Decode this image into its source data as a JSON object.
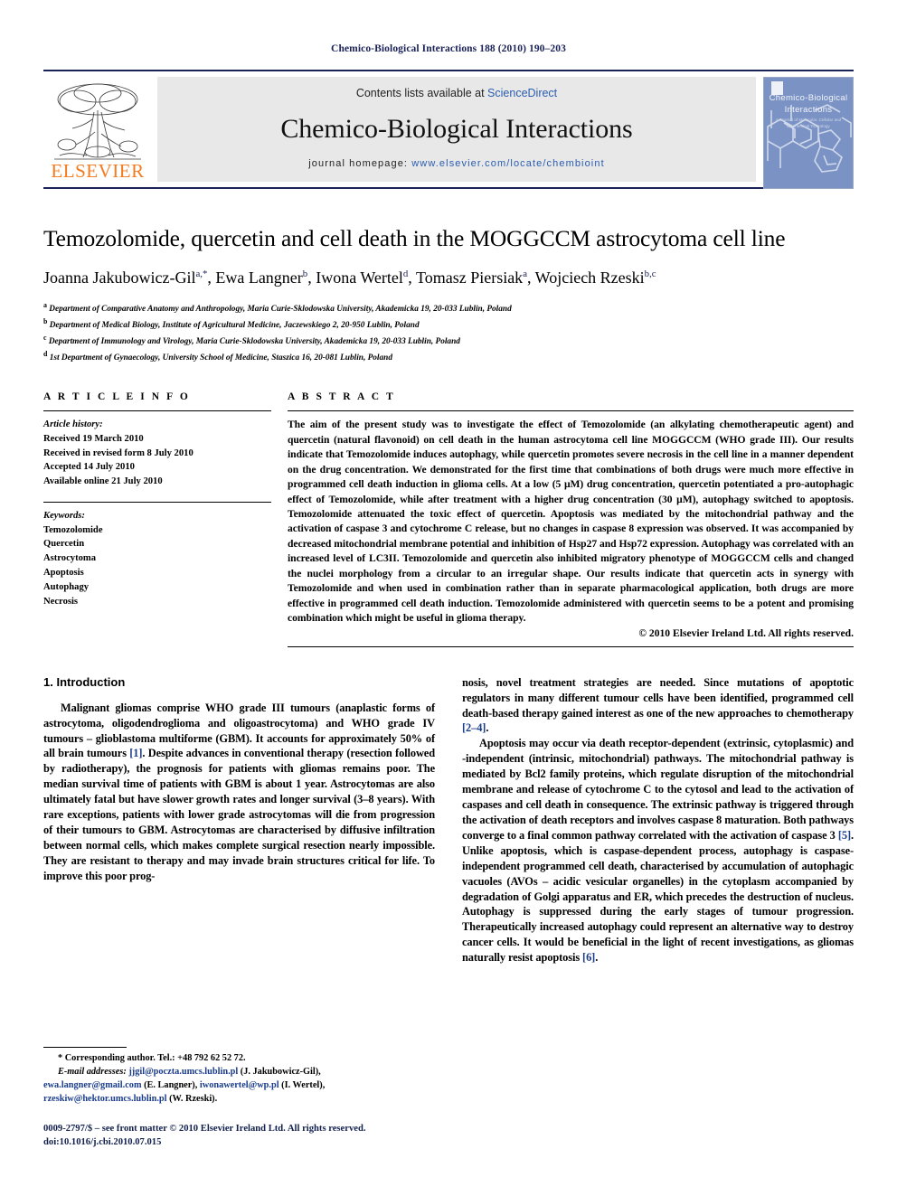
{
  "running_head": "Chemico-Biological Interactions 188 (2010) 190–203",
  "masthead": {
    "contents_prefix": "Contents lists available at ",
    "sciencedirect": "ScienceDirect",
    "journal_title": "Chemico-Biological Interactions",
    "homepage_prefix": "journal homepage: ",
    "homepage_url": "www.elsevier.com/locate/chembioint",
    "publisher": "ELSEVIER",
    "cover": {
      "line1": "Chemico-Biological",
      "line2": "Interactions",
      "line3": "A Journal of Molecular, Cellular and Biochemical Toxicology"
    },
    "accent_blue": "#1a2258",
    "link_blue": "#2a5db0",
    "elsevier_orange": "#f47b20",
    "cover_bg": "#7b93c4"
  },
  "article": {
    "title": "Temozolomide, quercetin and cell death in the MOGGCCM astrocytoma cell line",
    "authors_html": "Joanna Jakubowicz-Gil<sup>a,*</sup>, Ewa Langner<sup>b</sup>, Iwona Wertel<sup>d</sup>, Tomasz Piersiak<sup>a</sup>, Wojciech Rzeski<sup>b,c</sup>",
    "affiliations": [
      {
        "marker": "a",
        "text": "Department of Comparative Anatomy and Anthropology, Maria Curie-Sklodowska University, Akademicka 19, 20-033 Lublin, Poland"
      },
      {
        "marker": "b",
        "text": "Department of Medical Biology, Institute of Agricultural Medicine, Jaczewskiego 2, 20-950 Lublin, Poland"
      },
      {
        "marker": "c",
        "text": "Department of Immunology and Virology, Maria Curie-Sklodowska University, Akademicka 19, 20-033 Lublin, Poland"
      },
      {
        "marker": "d",
        "text": "1st Department of Gynaecology, University School of Medicine, Staszica 16, 20-081 Lublin, Poland"
      }
    ]
  },
  "info": {
    "label": "A R T I C L E   I N F O",
    "history_label": "Article history:",
    "history": [
      "Received 19 March 2010",
      "Received in revised form 8 July 2010",
      "Accepted 14 July 2010",
      "Available online 21 July 2010"
    ],
    "keywords_label": "Keywords:",
    "keywords": [
      "Temozolomide",
      "Quercetin",
      "Astrocytoma",
      "Apoptosis",
      "Autophagy",
      "Necrosis"
    ]
  },
  "abstract": {
    "label": "A B S T R A C T",
    "text": "The aim of the present study was to investigate the effect of Temozolomide (an alkylating chemotherapeutic agent) and quercetin (natural flavonoid) on cell death in the human astrocytoma cell line MOGGCCM (WHO grade III). Our results indicate that Temozolomide induces autophagy, while quercetin promotes severe necrosis in the cell line in a manner dependent on the drug concentration. We demonstrated for the first time that combinations of both drugs were much more effective in programmed cell death induction in glioma cells. At a low (5 μM) drug concentration, quercetin potentiated a pro-autophagic effect of Temozolomide, while after treatment with a higher drug concentration (30 μM), autophagy switched to apoptosis. Temozolomide attenuated the toxic effect of quercetin. Apoptosis was mediated by the mitochondrial pathway and the activation of caspase 3 and cytochrome C release, but no changes in caspase 8 expression was observed. It was accompanied by decreased mitochondrial membrane potential and inhibition of Hsp27 and Hsp72 expression. Autophagy was correlated with an increased level of LC3II. Temozolomide and quercetin also inhibited migratory phenotype of MOGGCCM cells and changed the nuclei morphology from a circular to an irregular shape. Our results indicate that quercetin acts in synergy with Temozolomide and when used in combination rather than in separate pharmacological application, both drugs are more effective in programmed cell death induction. Temozolomide administered with quercetin seems to be a potent and promising combination which might be useful in glioma therapy.",
    "copyright": "© 2010 Elsevier Ireland Ltd. All rights reserved."
  },
  "introduction": {
    "heading": "1. Introduction",
    "left_paragraph_1_pre": "Malignant gliomas comprise WHO grade III tumours (anaplastic forms of astrocytoma, oligodendroglioma and oligoastrocytoma) and WHO grade IV tumours – glioblastoma multiforme (GBM). It accounts for approximately 50% of all brain tumours ",
    "ref_1": "[1]",
    "left_paragraph_1_post": ". Despite advances in conventional therapy (resection followed by radiotherapy), the prognosis for patients with gliomas remains poor. The median survival time of patients with GBM is about 1 year. Astrocytomas are also ultimately fatal but have slower growth rates and longer survival (3–8 years). With rare exceptions, patients with lower grade astrocytomas will die from progression of their tumours to GBM. Astrocytomas are characterised by diffusive infiltration between normal cells, which makes complete surgical resection nearly impossible. They are resistant to therapy and may invade brain structures critical for life. To improve this poor prog-",
    "right_paragraph_1_pre": "nosis, novel treatment strategies are needed. Since mutations of apoptotic regulators in many different tumour cells have been identified, programmed cell death-based therapy gained interest as one of the new approaches to chemotherapy ",
    "ref_2_4": "[2–4]",
    "right_paragraph_1_post": ".",
    "right_paragraph_2_pre": "Apoptosis may occur via death receptor-dependent (extrinsic, cytoplasmic) and -independent (intrinsic, mitochondrial) pathways. The mitochondrial pathway is mediated by Bcl2 family proteins, which regulate disruption of the mitochondrial membrane and release of cytochrome C to the cytosol and lead to the activation of caspases and cell death in consequence. The extrinsic pathway is triggered through the activation of death receptors and involves caspase 8 maturation. Both pathways converge to a final common pathway correlated with the activation of caspase 3 ",
    "ref_5": "[5]",
    "right_paragraph_2_mid": ". Unlike apoptosis, which is caspase-dependent process, autophagy is caspase-independent programmed cell death, characterised by accumulation of autophagic vacuoles (AVOs – acidic vesicular organelles) in the cytoplasm accompanied by degradation of Golgi apparatus and ER, which precedes the destruction of nucleus. Autophagy is suppressed during the early stages of tumour progression. Therapeutically increased autophagy could represent an alternative way to destroy cancer cells. It would be beneficial in the light of recent investigations, as gliomas naturally resist apoptosis ",
    "ref_6": "[6]",
    "right_paragraph_2_post": "."
  },
  "footnotes": {
    "corresponding": "* Corresponding author. Tel.: +48 792 62 52 72.",
    "email_label": "E-mail addresses:",
    "emails": [
      {
        "address": "jjgil@poczta.umcs.lublin.pl",
        "person": " (J. Jakubowicz-Gil),"
      },
      {
        "address": "ewa.langner@gmail.com",
        "person": " (E. Langner),"
      },
      {
        "address": "iwonawertel@wp.pl",
        "person": " (I. Wertel),"
      },
      {
        "address": "rzeskiw@hektor.umcs.lublin.pl",
        "person": " (W. Rzeski)."
      }
    ],
    "imprint_line1": "0009-2797/$ – see front matter © 2010 Elsevier Ireland Ltd. All rights reserved.",
    "imprint_line2": "doi:10.1016/j.cbi.2010.07.015"
  }
}
